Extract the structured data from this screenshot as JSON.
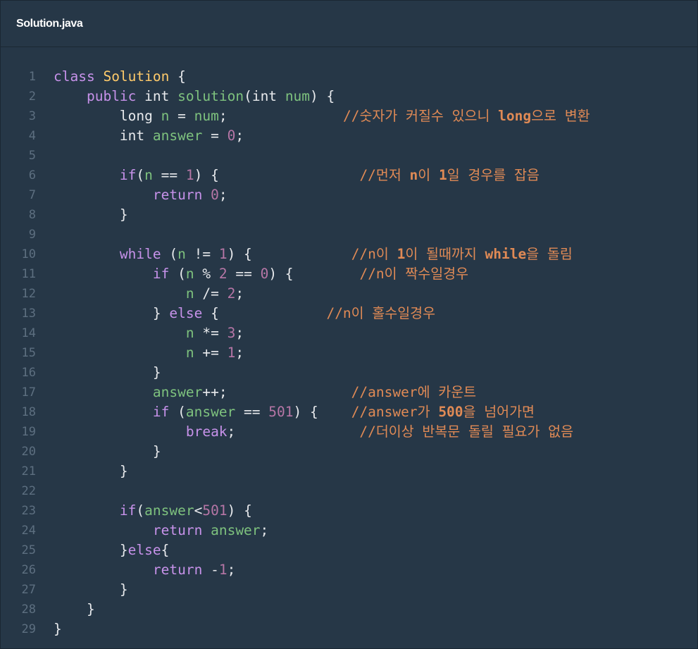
{
  "editor": {
    "file_name": "Solution.java"
  },
  "code": {
    "lines": [
      {
        "n": "1",
        "tokens": [
          [
            "kw",
            "class"
          ],
          [
            "op",
            " "
          ],
          [
            "cls",
            "Solution"
          ],
          [
            "op",
            " {"
          ]
        ]
      },
      {
        "n": "2",
        "tokens": [
          [
            "op",
            "    "
          ],
          [
            "kw",
            "public"
          ],
          [
            "op",
            " "
          ],
          [
            "ty",
            "int"
          ],
          [
            "op",
            " "
          ],
          [
            "fn",
            "solution"
          ],
          [
            "op",
            "("
          ],
          [
            "ty",
            "int"
          ],
          [
            "op",
            " "
          ],
          [
            "var",
            "num"
          ],
          [
            "op",
            ") {"
          ]
        ]
      },
      {
        "n": "3",
        "tokens": [
          [
            "op",
            "        "
          ],
          [
            "ty",
            "long"
          ],
          [
            "op",
            " "
          ],
          [
            "var",
            "n"
          ],
          [
            "op",
            " = "
          ],
          [
            "var",
            "num"
          ],
          [
            "op",
            ";              "
          ],
          [
            "cm",
            "//숫자가 커질수 있으니 "
          ],
          [
            "cmb",
            "long"
          ],
          [
            "cm",
            "으로 변환"
          ]
        ]
      },
      {
        "n": "4",
        "tokens": [
          [
            "op",
            "        "
          ],
          [
            "ty",
            "int"
          ],
          [
            "op",
            " "
          ],
          [
            "var",
            "answer"
          ],
          [
            "op",
            " = "
          ],
          [
            "num",
            "0"
          ],
          [
            "op",
            ";"
          ]
        ]
      },
      {
        "n": "5",
        "tokens": []
      },
      {
        "n": "6",
        "tokens": [
          [
            "op",
            "        "
          ],
          [
            "kw",
            "if"
          ],
          [
            "op",
            "("
          ],
          [
            "var",
            "n"
          ],
          [
            "op",
            " == "
          ],
          [
            "num",
            "1"
          ],
          [
            "op",
            ") {                 "
          ],
          [
            "cm",
            "//먼저 "
          ],
          [
            "cmb",
            "n"
          ],
          [
            "cm",
            "이 "
          ],
          [
            "cmb",
            "1"
          ],
          [
            "cm",
            "일 경우를 잡음"
          ]
        ]
      },
      {
        "n": "7",
        "tokens": [
          [
            "op",
            "            "
          ],
          [
            "kw",
            "return"
          ],
          [
            "op",
            " "
          ],
          [
            "num",
            "0"
          ],
          [
            "op",
            ";"
          ]
        ]
      },
      {
        "n": "8",
        "tokens": [
          [
            "op",
            "        }"
          ]
        ]
      },
      {
        "n": "9",
        "tokens": []
      },
      {
        "n": "10",
        "tokens": [
          [
            "op",
            "        "
          ],
          [
            "kw",
            "while"
          ],
          [
            "op",
            " ("
          ],
          [
            "var",
            "n"
          ],
          [
            "op",
            " != "
          ],
          [
            "num",
            "1"
          ],
          [
            "op",
            ") {            "
          ],
          [
            "cm",
            "//n이 "
          ],
          [
            "cmb",
            "1"
          ],
          [
            "cm",
            "이 될때까지 "
          ],
          [
            "cmb",
            "while"
          ],
          [
            "cm",
            "을 돌림"
          ]
        ]
      },
      {
        "n": "11",
        "tokens": [
          [
            "op",
            "            "
          ],
          [
            "kw",
            "if"
          ],
          [
            "op",
            " ("
          ],
          [
            "var",
            "n"
          ],
          [
            "op",
            " % "
          ],
          [
            "num",
            "2"
          ],
          [
            "op",
            " == "
          ],
          [
            "num",
            "0"
          ],
          [
            "op",
            ") {        "
          ],
          [
            "cm",
            "//n이 짝수일경우"
          ]
        ]
      },
      {
        "n": "12",
        "tokens": [
          [
            "op",
            "                "
          ],
          [
            "var",
            "n"
          ],
          [
            "op",
            " /= "
          ],
          [
            "num",
            "2"
          ],
          [
            "op",
            ";"
          ]
        ]
      },
      {
        "n": "13",
        "tokens": [
          [
            "op",
            "            } "
          ],
          [
            "kw",
            "else"
          ],
          [
            "op",
            " {             "
          ],
          [
            "cm",
            "//n이 홀수일경우"
          ]
        ]
      },
      {
        "n": "14",
        "tokens": [
          [
            "op",
            "                "
          ],
          [
            "var",
            "n"
          ],
          [
            "op",
            " *= "
          ],
          [
            "num",
            "3"
          ],
          [
            "op",
            ";"
          ]
        ]
      },
      {
        "n": "15",
        "tokens": [
          [
            "op",
            "                "
          ],
          [
            "var",
            "n"
          ],
          [
            "op",
            " += "
          ],
          [
            "num",
            "1"
          ],
          [
            "op",
            ";"
          ]
        ]
      },
      {
        "n": "16",
        "tokens": [
          [
            "op",
            "            }"
          ]
        ]
      },
      {
        "n": "17",
        "tokens": [
          [
            "op",
            "            "
          ],
          [
            "var",
            "answer"
          ],
          [
            "op",
            "++;               "
          ],
          [
            "cm",
            "//answer에 카운트"
          ]
        ]
      },
      {
        "n": "18",
        "tokens": [
          [
            "op",
            "            "
          ],
          [
            "kw",
            "if"
          ],
          [
            "op",
            " ("
          ],
          [
            "var",
            "answer"
          ],
          [
            "op",
            " == "
          ],
          [
            "num",
            "501"
          ],
          [
            "op",
            ") {    "
          ],
          [
            "cm",
            "//answer가 "
          ],
          [
            "cmb",
            "500"
          ],
          [
            "cm",
            "을 넘어가면"
          ]
        ]
      },
      {
        "n": "19",
        "tokens": [
          [
            "op",
            "                "
          ],
          [
            "kw",
            "break"
          ],
          [
            "op",
            ";               "
          ],
          [
            "cm",
            "//더이상 반복문 돌릴 필요가 없음"
          ]
        ]
      },
      {
        "n": "20",
        "tokens": [
          [
            "op",
            "            }"
          ]
        ]
      },
      {
        "n": "21",
        "tokens": [
          [
            "op",
            "        }"
          ]
        ]
      },
      {
        "n": "22",
        "tokens": []
      },
      {
        "n": "23",
        "tokens": [
          [
            "op",
            "        "
          ],
          [
            "kw",
            "if"
          ],
          [
            "op",
            "("
          ],
          [
            "var",
            "answer"
          ],
          [
            "op",
            "<"
          ],
          [
            "num",
            "501"
          ],
          [
            "op",
            ") {"
          ]
        ]
      },
      {
        "n": "24",
        "tokens": [
          [
            "op",
            "            "
          ],
          [
            "kw",
            "return"
          ],
          [
            "op",
            " "
          ],
          [
            "var",
            "answer"
          ],
          [
            "op",
            ";"
          ]
        ]
      },
      {
        "n": "25",
        "tokens": [
          [
            "op",
            "        }"
          ],
          [
            "kw",
            "else"
          ],
          [
            "op",
            "{"
          ]
        ]
      },
      {
        "n": "26",
        "tokens": [
          [
            "op",
            "            "
          ],
          [
            "kw",
            "return"
          ],
          [
            "op",
            " -"
          ],
          [
            "num",
            "1"
          ],
          [
            "op",
            ";"
          ]
        ]
      },
      {
        "n": "27",
        "tokens": [
          [
            "op",
            "        }"
          ]
        ]
      },
      {
        "n": "28",
        "tokens": [
          [
            "op",
            "    }"
          ]
        ]
      },
      {
        "n": "29",
        "tokens": [
          [
            "op",
            "}"
          ]
        ]
      }
    ]
  },
  "colors": {
    "background": "#263747",
    "keyword": "#c792ea",
    "class": "#ffcb6b",
    "identifier": "#7ec27e",
    "number": "#b676a6",
    "comment": "#e08a55",
    "line_number": "#5d6f80"
  }
}
